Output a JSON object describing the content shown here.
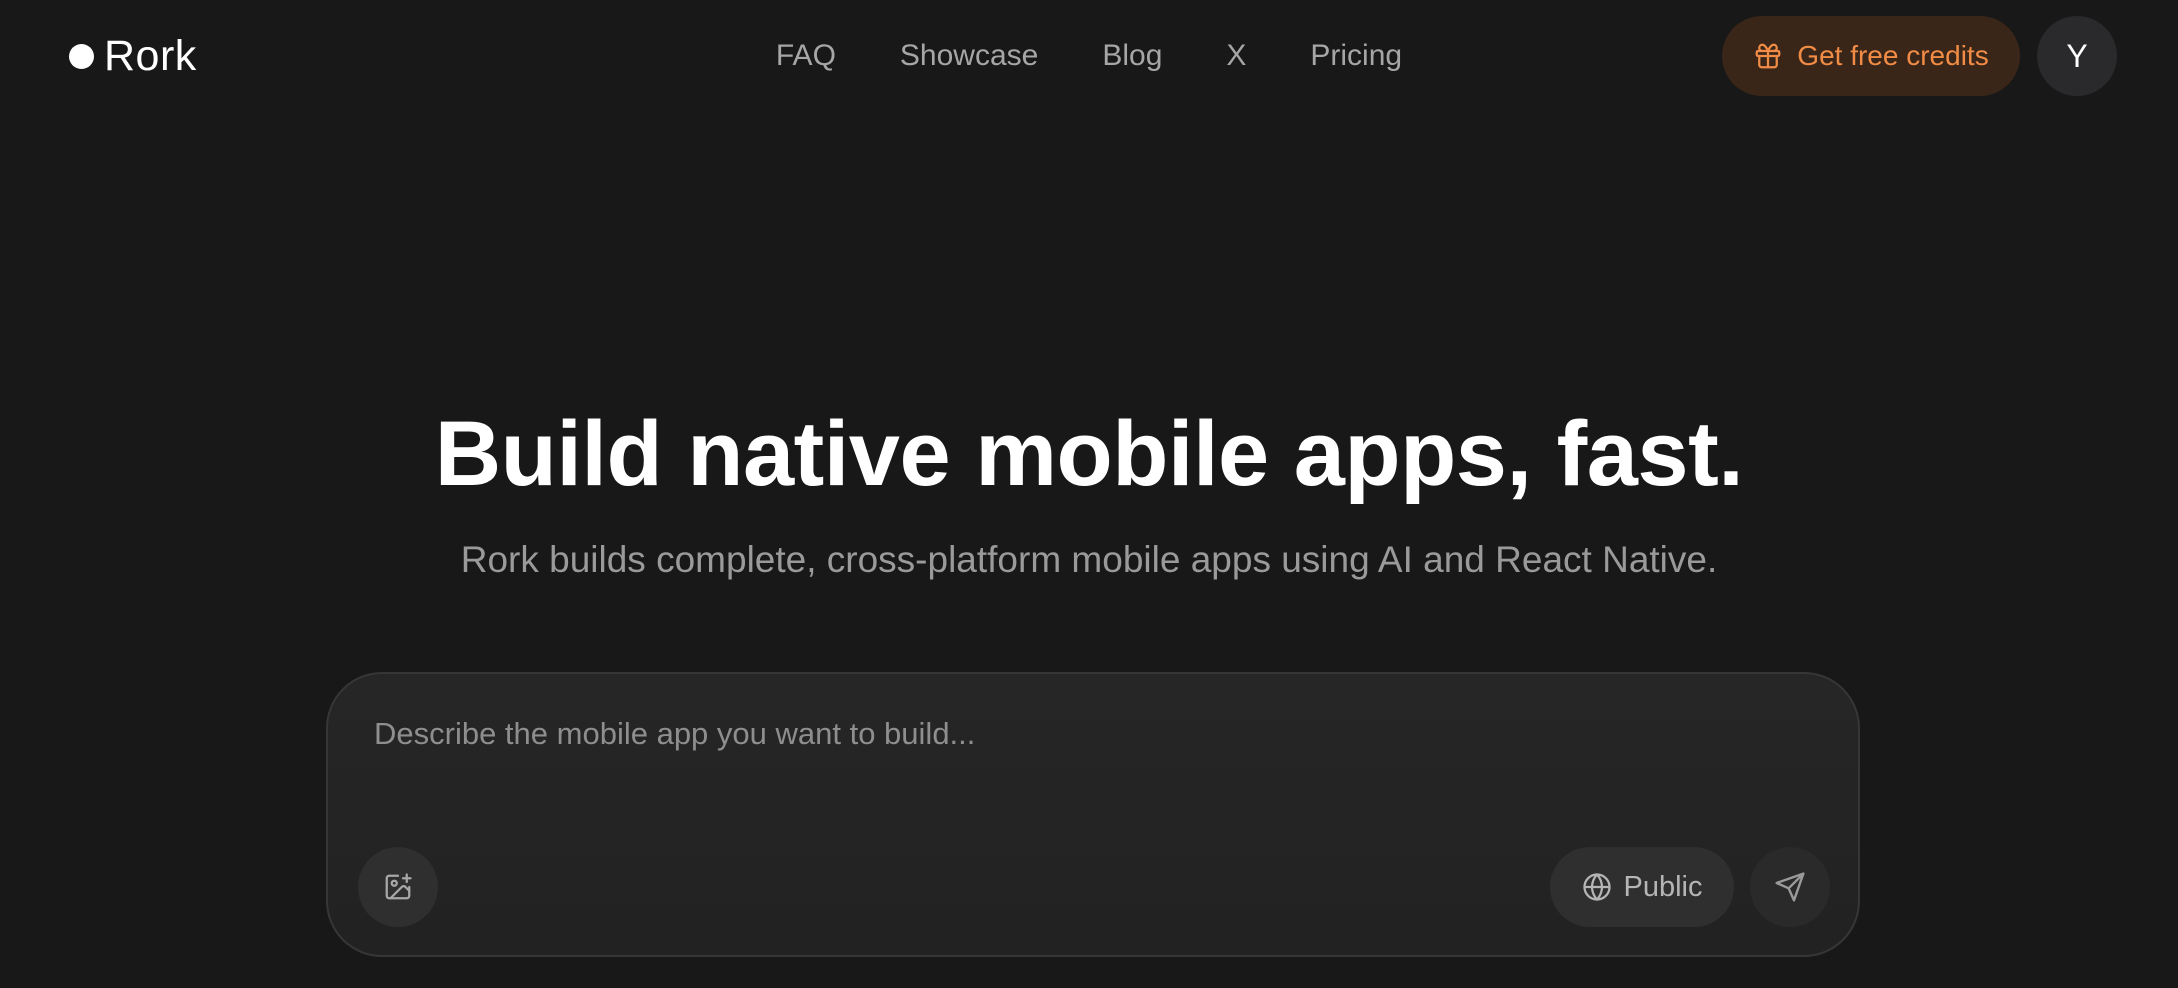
{
  "header": {
    "logo_text": "Rork",
    "nav": [
      {
        "label": "FAQ"
      },
      {
        "label": "Showcase"
      },
      {
        "label": "Blog"
      },
      {
        "label": "X"
      },
      {
        "label": "Pricing"
      }
    ],
    "credits_button": {
      "label": "Get free credits",
      "icon": "gift-icon"
    },
    "avatar_initial": "Y"
  },
  "hero": {
    "title": "Build native mobile apps, fast.",
    "subtitle": "Rork builds complete, cross-platform mobile apps using AI and React Native."
  },
  "prompt": {
    "placeholder": "Describe the mobile app you want to build...",
    "value": "",
    "attach_icon": "image-plus-icon",
    "visibility_label": "Public",
    "visibility_icon": "globe-icon",
    "send_icon": "send-icon"
  },
  "colors": {
    "background": "#181818",
    "accent": "#f08c45",
    "accent_bg": "#3a2519",
    "nav_text": "#a6a6a6",
    "prompt_bg": "#252525"
  }
}
